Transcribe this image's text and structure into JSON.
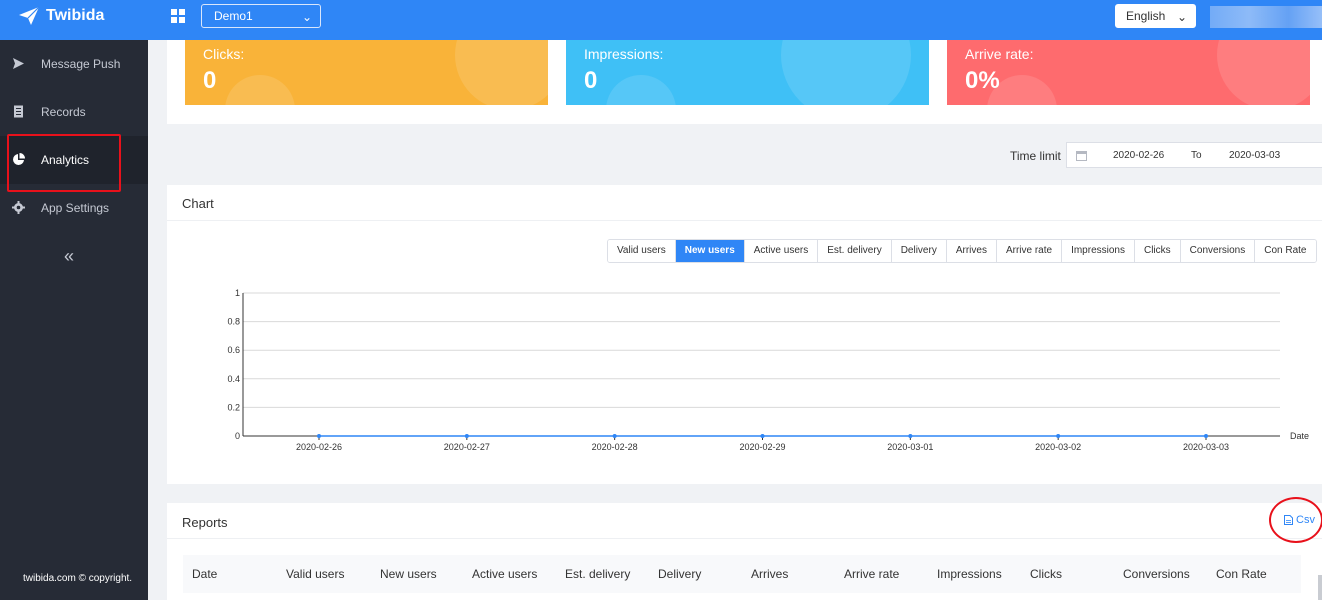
{
  "topbar": {
    "brand": "Twibida",
    "app_select": "Demo1",
    "language": "English",
    "colors": {
      "bar": "#2f86f6"
    }
  },
  "sidebar": {
    "items": [
      {
        "label": "Message Push",
        "icon": "send-icon"
      },
      {
        "label": "Records",
        "icon": "document-icon"
      },
      {
        "label": "Analytics",
        "icon": "pie-chart-icon",
        "active": true
      },
      {
        "label": "App Settings",
        "icon": "gear-icon"
      }
    ],
    "collapse": "«",
    "copyright": "twibida.com © copyright."
  },
  "stats": [
    {
      "label": "Clicks:",
      "value": "0",
      "color": "#f9b339"
    },
    {
      "label": "Impressions:",
      "value": "0",
      "color": "#3fc0f6"
    },
    {
      "label": "Arrive rate:",
      "value": "0%",
      "color": "#fe6b6e"
    }
  ],
  "filter": {
    "label": "Time limit",
    "from": "2020-02-26",
    "separator": "To",
    "to": "2020-03-03"
  },
  "chart": {
    "title": "Chart",
    "tabs": [
      "Valid users",
      "New users",
      "Active users",
      "Est. delivery",
      "Delivery",
      "Arrives",
      "Arrive rate",
      "Impressions",
      "Clicks",
      "Conversions",
      "Con Rate"
    ],
    "active_tab": "New users"
  },
  "chart_data": {
    "type": "line",
    "title": "",
    "xlabel": "Date",
    "ylabel": "",
    "x": [
      "2020-02-26",
      "2020-02-27",
      "2020-02-28",
      "2020-02-29",
      "2020-03-01",
      "2020-03-02",
      "2020-03-03"
    ],
    "series": [
      {
        "values": [
          0,
          0,
          0,
          0,
          0,
          0,
          0
        ]
      }
    ],
    "yticks": [
      "0",
      "0.2",
      "0.4",
      "0.6",
      "0.8",
      "1"
    ],
    "ylim": [
      0,
      1
    ],
    "grid": true,
    "line_color": "#2f86f6"
  },
  "reports": {
    "title": "Reports",
    "csv_label": "Csv",
    "columns": [
      "Date",
      "Valid users",
      "New users",
      "Active users",
      "Est. delivery",
      "Delivery",
      "Arrives",
      "Arrive rate",
      "Impressions",
      "Clicks",
      "Conversions",
      "Con Rate"
    ]
  }
}
